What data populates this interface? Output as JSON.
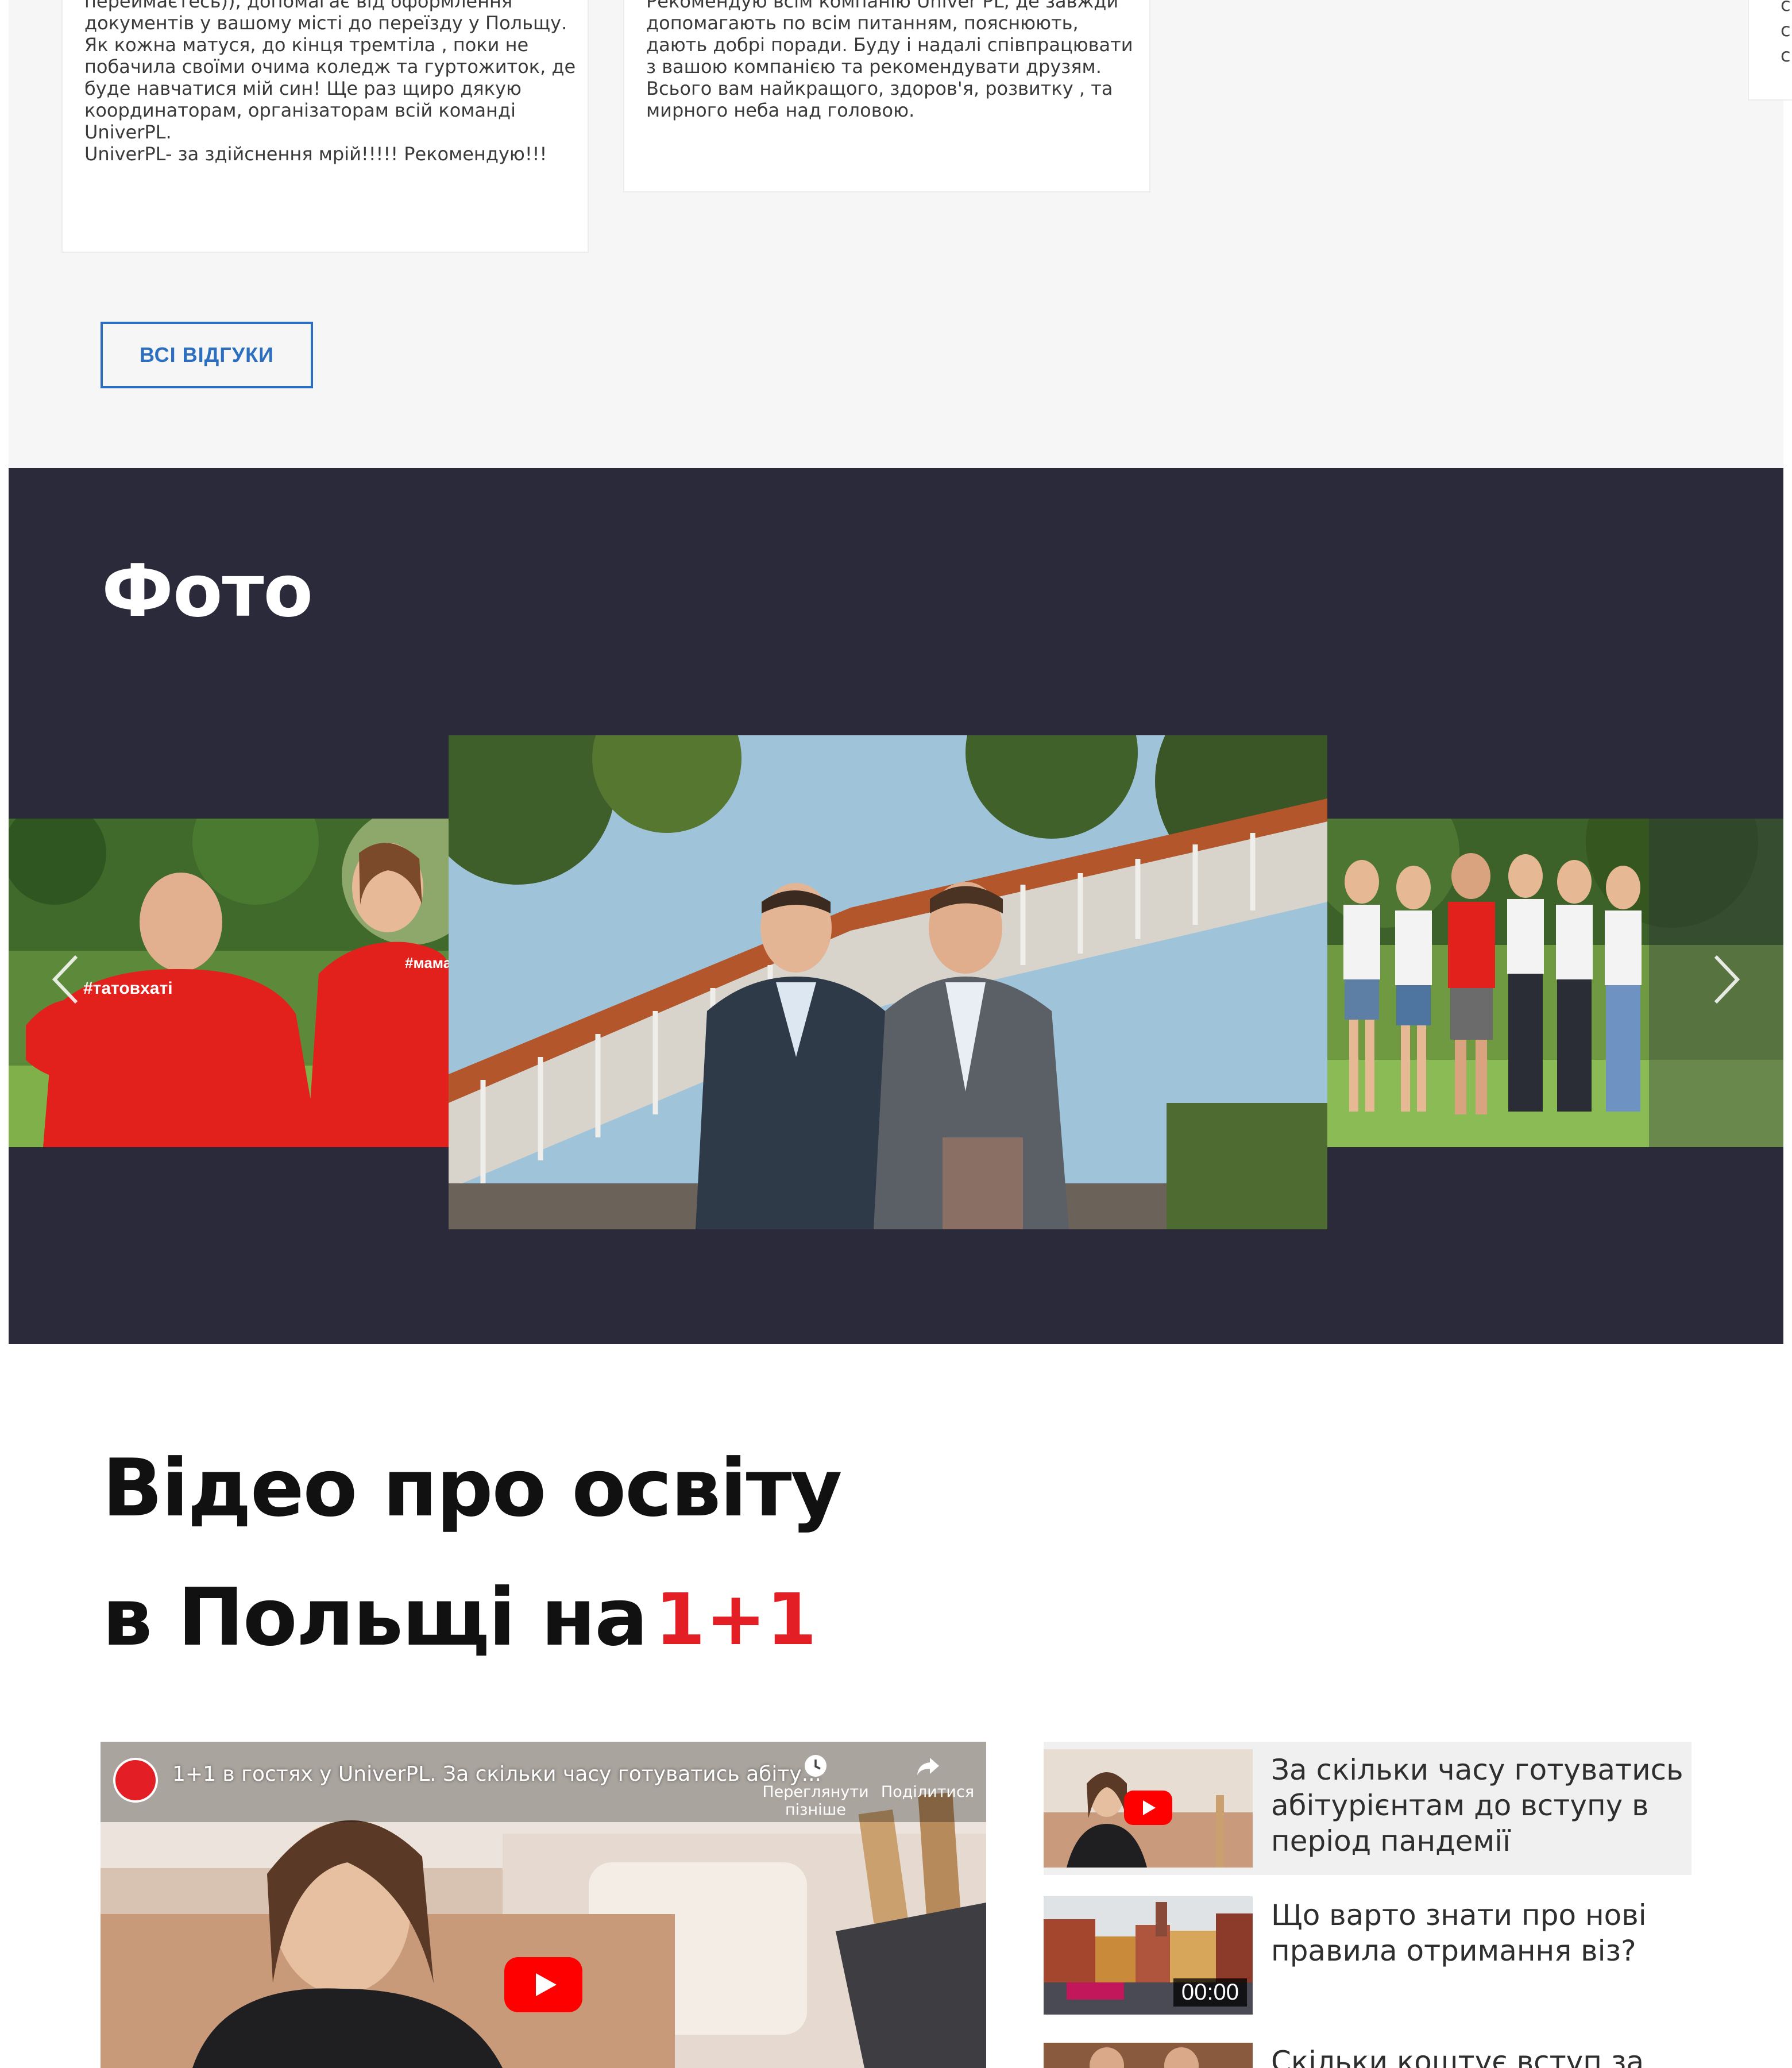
{
  "reviews": {
    "card1_lines": [
      "переймаєтесь)), допомагає від оформлення",
      "документів у вашому місті до переїзду у Польщу.",
      "Як кожна матуся, до кінця тремтіла , поки не",
      "побачила своїми очима коледж та гуртожиток, де",
      "буде навчатися мій син! Ще раз щиро дякую",
      "координаторам, організаторам всій команді",
      "UniverPL.",
      "UniverPL- за здійснення мрій!!!!! Рекомендую!!!"
    ],
    "card2_lines": [
      "Рекомендую всім компанію Univer PL, де завжди",
      "допомагають по всім питанням, пояснюють,",
      "дають добрі поради. Буду і надалі співпрацювати",
      "з вашою компанією та рекомендувати друзям.",
      "Всього вам найкращого, здоров'я, розвитку , та",
      "мирного неба над головою."
    ],
    "card3_lines": [
      "с",
      "с",
      "с"
    ],
    "all_reviews_label": "ВСІ ВІДГУКИ"
  },
  "photo": {
    "title": "Фото",
    "left_shirt_text": "#татовхаті",
    "left_shirt_text2": "#мама"
  },
  "video": {
    "title_line1": "Відео про освіту",
    "title_line2": "в Польщі на",
    "logo_text": "1+1",
    "player": {
      "title": "1+1 в гостях у UniverPL. За скільки часу готуватись абіту...",
      "watch_later": "Переглянути пізніше",
      "share": "Поділитися"
    },
    "playlist": [
      {
        "title": "За скільки часу готуватись абітурієнтам до вступу в період пандемії",
        "duration": ""
      },
      {
        "title": "Що варто знати про нові правила отримання віз?",
        "duration": "00:00"
      },
      {
        "title": "Скільки коштує вступ за",
        "duration": ""
      }
    ]
  },
  "colors": {
    "accent_blue": "#2c6fc1",
    "dark_section": "#2a2a3b",
    "brand_red": "#e31e24"
  }
}
